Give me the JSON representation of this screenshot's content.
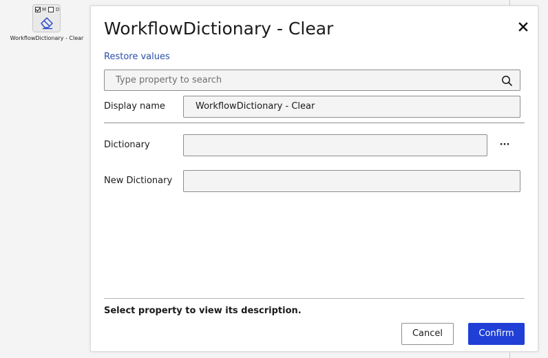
{
  "canvas": {
    "node": {
      "flag_m": "M",
      "flag_d": "D",
      "checkbox_1_checked": true,
      "checkbox_2_checked": false,
      "icon": "eraser-icon",
      "label": "WorkflowDictionary - Clear"
    }
  },
  "dialog": {
    "title": "WorkflowDictionary - Clear",
    "close_icon": "close-icon",
    "restore_link": "Restore values",
    "search": {
      "placeholder": "Type property to search",
      "value": "",
      "icon": "search-icon"
    },
    "display_name": {
      "label": "Display name",
      "value": "WorkflowDictionary - Clear"
    },
    "properties": [
      {
        "label": "Dictionary",
        "value": "",
        "has_ellipsis": true,
        "ellipsis_label": "···"
      },
      {
        "label": "New Dictionary",
        "value": ""
      }
    ],
    "description": "Select property to view its description.",
    "buttons": {
      "cancel": "Cancel",
      "confirm": "Confirm"
    }
  },
  "colors": {
    "accent": "#1f3fd6",
    "link": "#2a4fa8",
    "field_bg": "#f4f4f4",
    "border": "#8d8d8d"
  }
}
